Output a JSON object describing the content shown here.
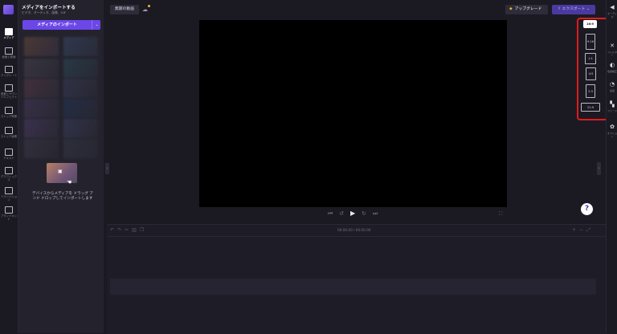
{
  "rail": {
    "items": [
      {
        "label": "メディア",
        "icon": "folder-icon",
        "active": true
      },
      {
        "label": "画面と録画",
        "icon": "video-camera-icon"
      },
      {
        "label": "テンプレート",
        "icon": "template-grid-icon"
      },
      {
        "label": "音楽とサウンドエフェクト",
        "icon": "music-note-icon"
      },
      {
        "label": "ストック映像",
        "icon": "film-icon"
      },
      {
        "label": "ストック画像",
        "icon": "image-icon"
      },
      {
        "label": "テキスト",
        "icon": "text-icon"
      },
      {
        "label": "グラフィックス",
        "icon": "shapes-icon"
      },
      {
        "label": "トランジション",
        "icon": "transition-icon"
      },
      {
        "label": "ブランドキット",
        "icon": "brand-kit-icon"
      }
    ]
  },
  "panel": {
    "title": "メディアをインポートする",
    "subtitle": "ビデオ、オーディオ、画像、GIF",
    "import_label": "メディアのインポート",
    "import_caret": "⌄",
    "drop_text": "デバイスからメディアを ドラッグ アンド ドロップしてインポートします"
  },
  "topbar": {
    "project_title": "無題の動画",
    "upgrade_label": "アップグレード",
    "export_label": "エクスポート",
    "export_caret": "⌄"
  },
  "aspect_ratios": {
    "selected": "16:9",
    "options": [
      "9:16",
      "1:1",
      "4:5",
      "2:3",
      "21:9"
    ]
  },
  "right_rail": {
    "items": [
      {
        "label": "オーディオ",
        "icon": "speaker-icon"
      },
      {
        "label": "フィルター",
        "icon": "magic-icon"
      },
      {
        "label": "色調補正",
        "icon": "contrast-icon"
      },
      {
        "label": "速度",
        "icon": "speed-icon"
      },
      {
        "label": "フェード",
        "icon": "fade-icon"
      },
      {
        "label": "オプション",
        "icon": "options-icon"
      }
    ]
  },
  "timeline": {
    "time": "00:00.00 / 00:00.00"
  },
  "help": {
    "label": "?"
  },
  "colors": {
    "accent": "#6b47e8",
    "highlight": "#e01b1b",
    "upgrade_gem": "#f0b429"
  }
}
